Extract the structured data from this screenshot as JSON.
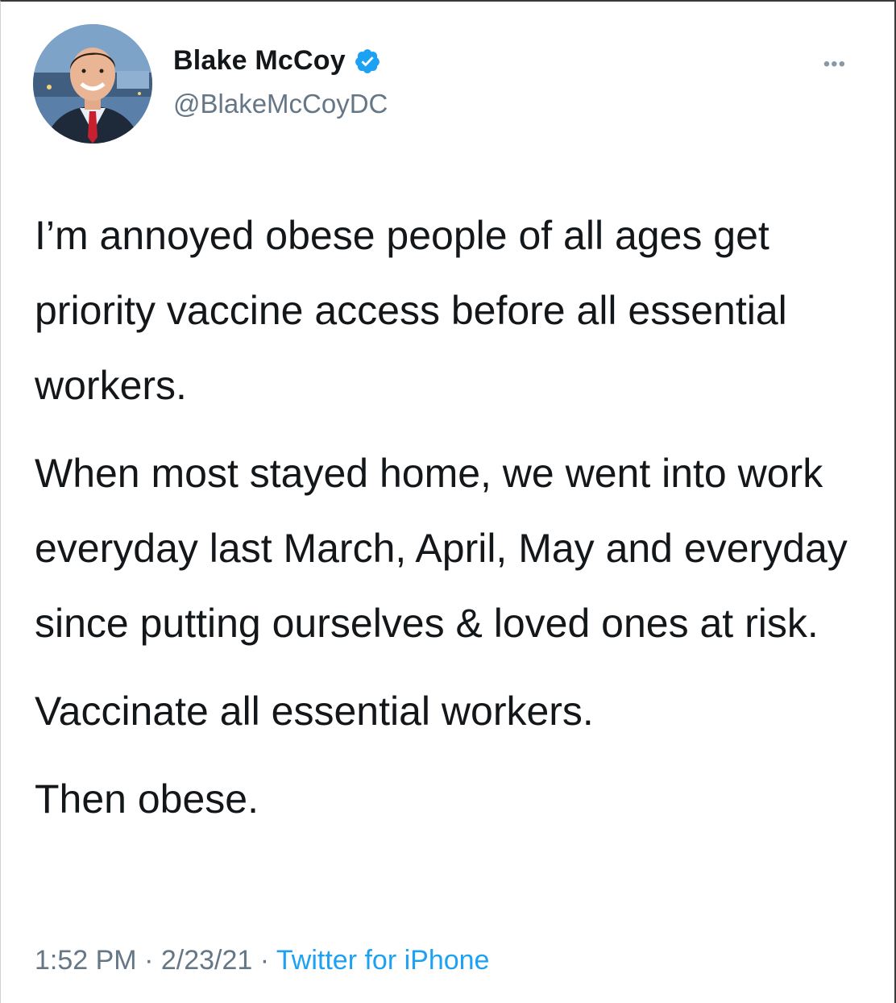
{
  "author": {
    "display_name": "Blake McCoy",
    "handle": "@BlakeMcCoyDC",
    "verified": true
  },
  "icons": {
    "verified": "verified-badge-icon",
    "more": "more-options-icon",
    "more_glyph": "•••"
  },
  "tweet": {
    "paragraphs": [
      "I’m annoyed obese people of all ages get priority vaccine access before all essential workers.",
      "When most stayed home, we went into work everyday last March, April, May and everyday since putting ourselves & loved ones at risk.",
      "Vaccinate all essential workers.",
      "Then obese."
    ]
  },
  "meta": {
    "time": "1:52 PM",
    "separator": " · ",
    "date": "2/23/21",
    "source": "Twitter for iPhone"
  },
  "colors": {
    "text": "#14171a",
    "secondary": "#657786",
    "accent": "#1da1f2"
  }
}
